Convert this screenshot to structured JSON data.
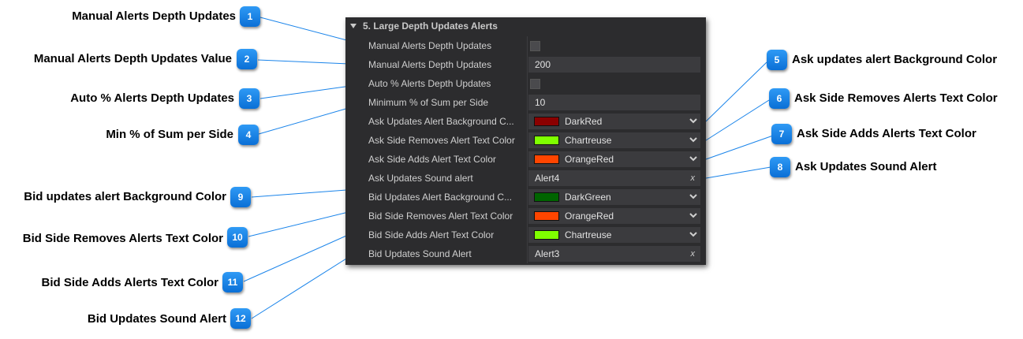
{
  "panel": {
    "title": "5. Large Depth Updates Alerts",
    "rows": [
      {
        "label": "Manual Alerts Depth Updates",
        "type": "checkbox",
        "value": ""
      },
      {
        "label": "Manual Alerts Depth Updates",
        "type": "text",
        "value": "200"
      },
      {
        "label": "Auto % Alerts Depth Updates",
        "type": "checkbox",
        "value": ""
      },
      {
        "label": "Minimum % of Sum per Side",
        "type": "text",
        "value": "10"
      },
      {
        "label": "Ask Updates Alert Background C...",
        "type": "color",
        "value": "DarkRed",
        "color": "#8b0000"
      },
      {
        "label": "Ask Side Removes Alert Text Color",
        "type": "color",
        "value": "Chartreuse",
        "color": "#7fff00"
      },
      {
        "label": "Ask Side Adds Alert Text Color",
        "type": "color",
        "value": "OrangeRed",
        "color": "#ff4500"
      },
      {
        "label": "Ask Updates Sound alert",
        "type": "sound",
        "value": "Alert4"
      },
      {
        "label": "Bid Updates Alert Background C...",
        "type": "color",
        "value": "DarkGreen",
        "color": "#006400"
      },
      {
        "label": "Bid Side Removes Alert Text Color",
        "type": "color",
        "value": "OrangeRed",
        "color": "#ff4500"
      },
      {
        "label": "Bid Side Adds Alert Text Color",
        "type": "color",
        "value": "Chartreuse",
        "color": "#7fff00"
      },
      {
        "label": "Bid Updates Sound Alert",
        "type": "sound",
        "value": "Alert3"
      }
    ]
  },
  "annotations": [
    {
      "n": "1",
      "text": "Manual Alerts Depth Updates"
    },
    {
      "n": "2",
      "text": "Manual Alerts Depth Updates Value"
    },
    {
      "n": "3",
      "text": "Auto % Alerts Depth Updates"
    },
    {
      "n": "4",
      "text": "Min % of Sum per Side"
    },
    {
      "n": "5",
      "text": "Ask updates alert Background Color"
    },
    {
      "n": "6",
      "text": "Ask Side Removes Alerts Text Color"
    },
    {
      "n": "7",
      "text": "Ask Side Adds Alerts Text Color"
    },
    {
      "n": "8",
      "text": "Ask Updates Sound Alert"
    },
    {
      "n": "9",
      "text": "Bid updates alert Background Color"
    },
    {
      "n": "10",
      "text": "Bid Side Removes Alerts Text Color"
    },
    {
      "n": "11",
      "text": "Bid Side Adds Alerts Text Color"
    },
    {
      "n": "12",
      "text": "Bid Updates Sound Alert"
    }
  ],
  "icons": {
    "collapse": "triangle-down-icon",
    "dropdown": "chevron-down-icon",
    "clear": "x-icon"
  },
  "colors": {
    "badge": "#1a84ea",
    "panel_bg": "#2c2c2e",
    "leader": "#1a84ea"
  }
}
